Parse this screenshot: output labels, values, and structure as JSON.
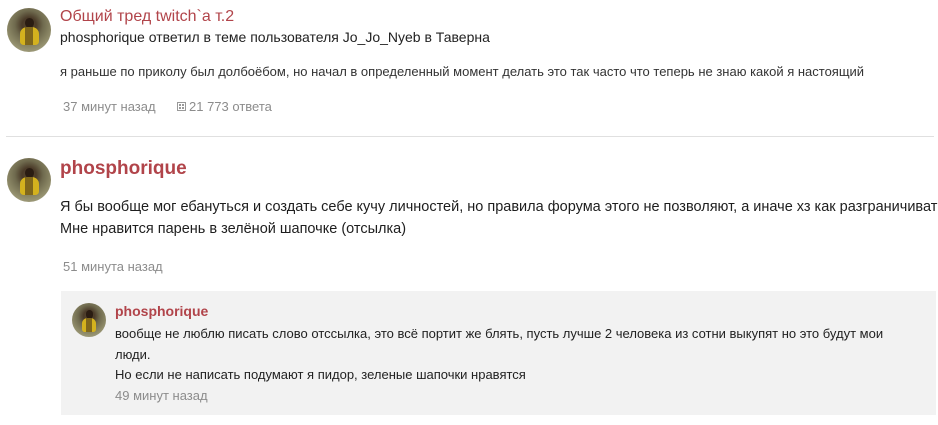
{
  "activity": {
    "thread_title": "Общий тред twitch`а т.2",
    "author": "phosphorique",
    "action_text": "ответил в теме пользователя",
    "thread_owner": "Jo_Jo_Nyeb",
    "in_text": "в",
    "forum": "Таверна",
    "excerpt": "я раньше по приколу был долбоёбом, но начал в определенный момент делать это так часто что теперь не знаю какой я настоящий",
    "time": "37 минут назад",
    "replies": "21 773 ответа",
    "replies_icon": "comments-icon"
  },
  "post": {
    "author": "phosphorique",
    "text_line1": "Я бы вообще мог ебануться и создать себе кучу личностей, но правила форума этого не позволяют, а иначе хз как разграничивать.",
    "text_line2": "Мне нравится парень в зелёной шапочке (отсылка)",
    "time": "51 минута назад"
  },
  "comment": {
    "author": "phosphorique",
    "text_line1": "вообще не люблю писать слово отссылка, это всё портит же блять, пусть лучше 2 человека из сотни выкупят но это будут мои",
    "text_line2": "люди.",
    "text_line3": "Но если не написать подумают я пидор, зеленые шапочки нравятся",
    "time": "49 минут назад"
  },
  "colors": {
    "accent": "#b1444a",
    "meta": "#8c8c8c",
    "comment_bg": "#f2f2f2",
    "divider": "#e0e0e0"
  }
}
